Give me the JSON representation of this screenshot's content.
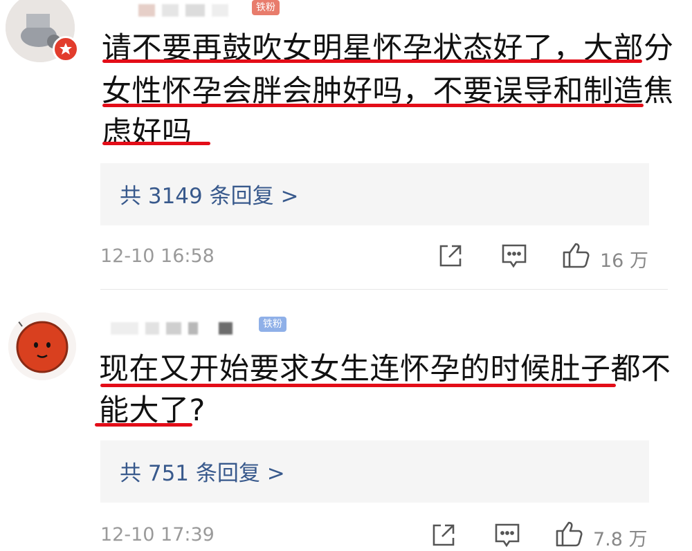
{
  "comments": [
    {
      "fan_badge": "铁粉",
      "lines": [
        "请不要再鼓吹女明星怀孕状态好了，大部分",
        "女性怀孕会胖会肿好吗，不要误导和制造焦",
        "虑好吗"
      ],
      "replies": "共 3149 条回复 >",
      "time": "12-10 16:58",
      "likes": "16 万"
    },
    {
      "fan_badge": "铁粉",
      "lines": [
        "现在又开始要求女生连怀孕的时候肚子都不",
        "能大了?"
      ],
      "replies": "共 751 条回复 >",
      "time": "12-10 17:39",
      "likes": "7.8 万"
    }
  ],
  "colors": {
    "underline": "#e30d18",
    "reply_link": "#38598c",
    "meta": "#9a9a9a"
  }
}
